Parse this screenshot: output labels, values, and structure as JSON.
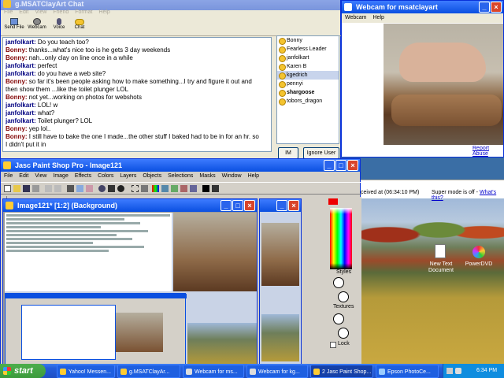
{
  "chat": {
    "title": "g.MSATClayArt Chat",
    "menu": [
      "File",
      "Edit",
      "View",
      "Friend",
      "Format",
      "Help"
    ],
    "toolbar": [
      "Send File",
      "Webcam",
      "Voice",
      "Chat"
    ],
    "messages": [
      {
        "user": "janfolkart:",
        "text": " Do you teach too?"
      },
      {
        "user": "Bonny:",
        "text": " thanks...what's nice too is he gets 3 day weekends"
      },
      {
        "user": "Bonny:",
        "text": " nah...only clay on line once in a while"
      },
      {
        "user": "janfolkart:",
        "text": " perfect"
      },
      {
        "user": "janfolkart:",
        "text": " do you have a web site?"
      },
      {
        "user": "Bonny:",
        "text": " so far it's been people asking how to make something...I try and figure it out and"
      },
      {
        "user": "",
        "text": "  then show them ...like the toilet plunger LOL"
      },
      {
        "user": "Bonny:",
        "text": " not yet...working on photos for webshots"
      },
      {
        "user": "janfolkart:",
        "text": " LOL! w"
      },
      {
        "user": "janfolkart:",
        "text": " what?"
      },
      {
        "user": "janfolkart:",
        "text": " Toilet plunger? LOL"
      },
      {
        "user": "Bonny:",
        "text": " yep lol.."
      },
      {
        "user": "Bonny:",
        "text": " I still have to bake the one I made...the other stuff I baked had to be in for an hr. so"
      },
      {
        "user": "",
        "text": "  I didn't put it in"
      }
    ],
    "users": [
      "Bonny",
      "Fearless Leader",
      "janfolkart",
      "Karen B",
      "kgedrich",
      "pennyi",
      "shargoose",
      "tobors_dragon"
    ],
    "selected_user": "kgedrich",
    "im_button": "IM",
    "ignore_button": "Ignore User"
  },
  "webcam": {
    "title": "Webcam for msatclayart",
    "menu": [
      "Webcam",
      "Help"
    ],
    "report_link": "Report Abuse",
    "received": "ceived at (06:34:10 PM)",
    "super_mode": "Super mode is off - ",
    "whats_this": "What's this?"
  },
  "psp": {
    "title": "Jasc Paint Shop Pro - Image121",
    "menu": [
      "File",
      "Edit",
      "View",
      "Image",
      "Effects",
      "Colors",
      "Layers",
      "Objects",
      "Selections",
      "Masks",
      "Window",
      "Help"
    ],
    "image_title": "Image121* [1:2] (Background)",
    "palette": {
      "styles": "Styles",
      "textures": "Textures",
      "lock": "Lock"
    }
  },
  "desktop": {
    "icons": [
      "New Text Document",
      "PowerDVD"
    ]
  },
  "taskbar": {
    "start": "start",
    "tasks": [
      "Yahoo! Messen...",
      "g.MSATClayAr...",
      "Webcam for ms...",
      "Webcam for kg...",
      "2 Jasc Paint Shop...",
      "Epson PhotoCe..."
    ],
    "time": "6:34 PM"
  },
  "colors": {
    "title_active": "#0a4fe0",
    "taskbar": "#245edb",
    "start": "#3c9a3c"
  }
}
